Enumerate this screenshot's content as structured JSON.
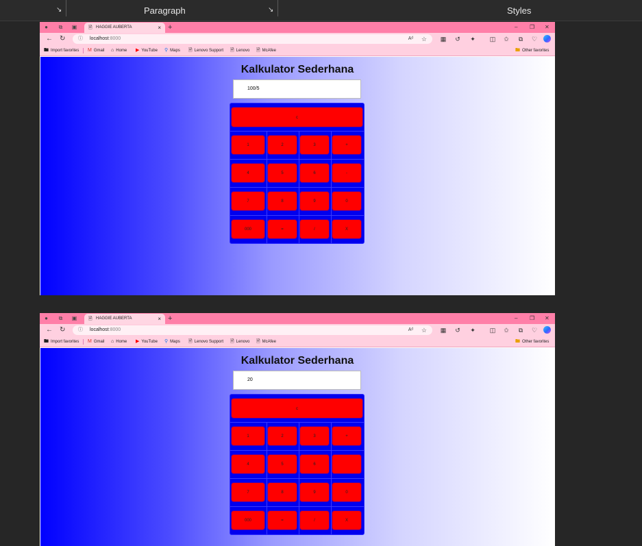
{
  "ribbon": {
    "groups": [
      {
        "label": ""
      },
      {
        "label": "Paragraph"
      },
      {
        "label": "Styles"
      }
    ]
  },
  "shots": [
    {
      "tab_title": "HAGGIE AUBERTA",
      "url_host": "localhost",
      "url_port": ":8000",
      "favorites": [
        "Import favorites",
        "Gmail",
        "Home",
        "YouTube",
        "Maps",
        "Lenovo Support",
        "Lenovo",
        "McAfee"
      ],
      "other_favorites": "Other favorites",
      "calculator": {
        "title": "Kalkulator Sederhana",
        "display": "100/5",
        "clear": "c",
        "rows": [
          [
            "1",
            "2",
            "3",
            "+"
          ],
          [
            "4",
            "5",
            "6",
            "-"
          ],
          [
            "7",
            "8",
            "9",
            "0"
          ],
          [
            "000",
            "=",
            "/",
            "X"
          ]
        ]
      }
    },
    {
      "tab_title": "HAGGIE AUBERTA",
      "url_host": "localhost",
      "url_port": ":8000",
      "favorites": [
        "Import favorites",
        "Gmail",
        "Home",
        "YouTube",
        "Maps",
        "Lenovo Support",
        "Lenovo",
        "McAfee"
      ],
      "other_favorites": "Other favorites",
      "calculator": {
        "title": "Kalkulator Sederhana",
        "display": "20",
        "clear": "c",
        "rows": [
          [
            "1",
            "2",
            "3",
            "+"
          ],
          [
            "4",
            "5",
            "6",
            ""
          ],
          [
            "7",
            "8",
            "9",
            "0"
          ],
          [
            "000",
            "=",
            "/",
            "X"
          ]
        ]
      }
    }
  ]
}
